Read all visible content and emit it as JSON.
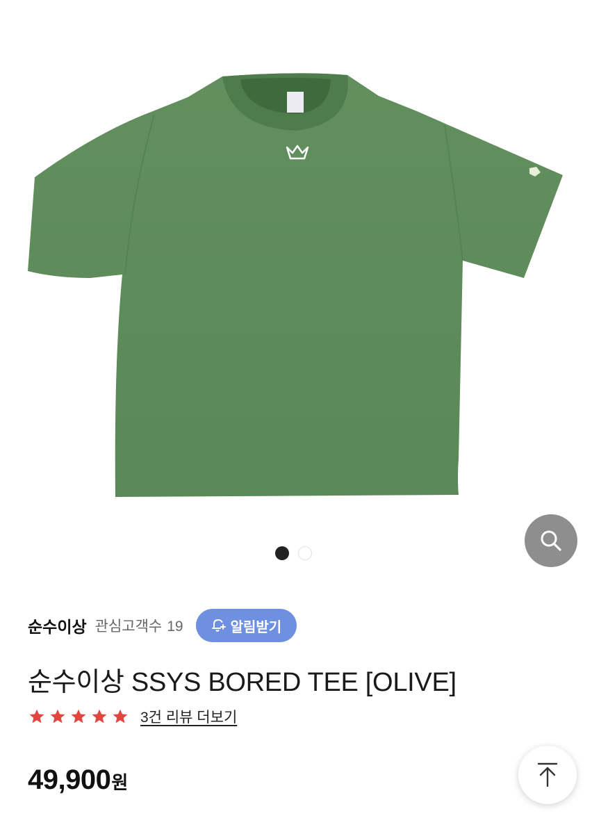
{
  "gallery": {
    "image_alt": "olive t-shirt",
    "zoom_icon": "search-icon",
    "slides_total": 2,
    "current_slide": 1
  },
  "brand": {
    "name": "순수이상",
    "followers_label": "관심고객수",
    "followers_count": "19",
    "notify_label": "알림받기",
    "notify_icon": "bell-plus-icon"
  },
  "product": {
    "title": "순수이상 SSYS BORED TEE [OLIVE]",
    "rating": 5,
    "rating_max": 5,
    "review_link": "3건 리뷰 더보기",
    "price": "49,900",
    "price_unit": "원"
  },
  "scroll_top_icon": "arrow-up-icon",
  "colors": {
    "shirt": "#5e8d5a",
    "star": "#e2473f",
    "notify_button": "#6f8fe0",
    "zoom_button": "#8e8e8e"
  }
}
